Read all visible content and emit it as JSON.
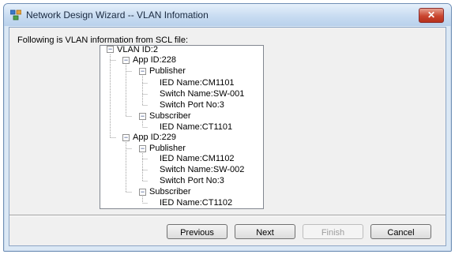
{
  "window": {
    "title": "Network Design Wizard -- VLAN Infomation",
    "close_label": "✕"
  },
  "intro_text": "Following is VLAN information from SCL file:",
  "tree": {
    "vlan": "VLAN ID:2",
    "app1": "App ID:228",
    "app1_publisher": "Publisher",
    "app1_pub_ied": "IED Name:CM1101",
    "app1_pub_switch": "Switch Name:SW-001",
    "app1_pub_port": "Switch Port No:3",
    "app1_subscriber": "Subscriber",
    "app1_sub_ied": "IED Name:CT1101",
    "app2": "App ID:229",
    "app2_publisher": "Publisher",
    "app2_pub_ied": "IED Name:CM1102",
    "app2_pub_switch": "Switch Name:SW-002",
    "app2_pub_port": "Switch Port No:3",
    "app2_subscriber": "Subscriber",
    "app2_sub_ied": "IED Name:CT1102",
    "expander_symbol": "−"
  },
  "buttons": {
    "previous": "Previous",
    "next": "Next",
    "finish": "Finish",
    "cancel": "Cancel"
  }
}
